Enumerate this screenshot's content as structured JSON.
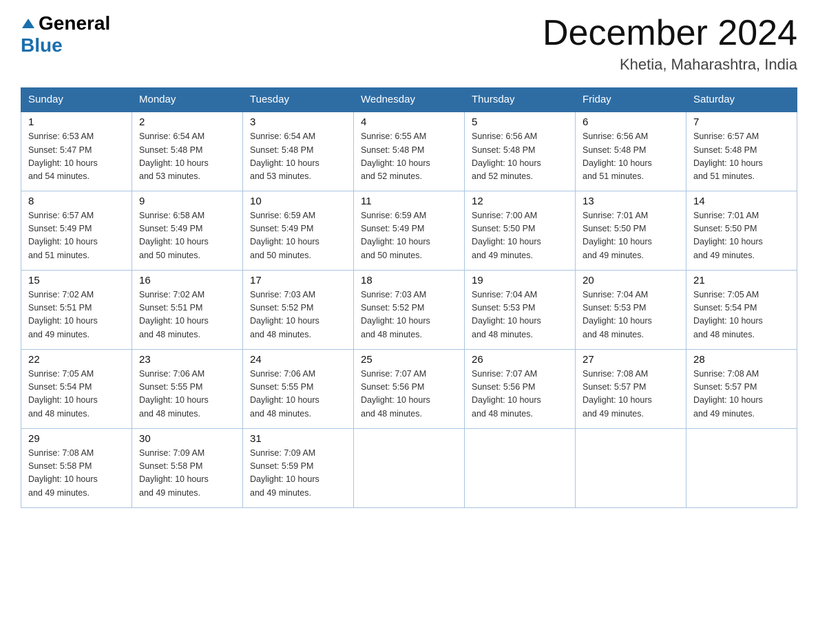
{
  "logo": {
    "part1": "General",
    "part2": "Blue"
  },
  "header": {
    "month_year": "December 2024",
    "location": "Khetia, Maharashtra, India"
  },
  "days_of_week": [
    "Sunday",
    "Monday",
    "Tuesday",
    "Wednesday",
    "Thursday",
    "Friday",
    "Saturday"
  ],
  "weeks": [
    [
      {
        "day": "1",
        "sunrise": "6:53 AM",
        "sunset": "5:47 PM",
        "daylight": "10 hours and 54 minutes."
      },
      {
        "day": "2",
        "sunrise": "6:54 AM",
        "sunset": "5:48 PM",
        "daylight": "10 hours and 53 minutes."
      },
      {
        "day": "3",
        "sunrise": "6:54 AM",
        "sunset": "5:48 PM",
        "daylight": "10 hours and 53 minutes."
      },
      {
        "day": "4",
        "sunrise": "6:55 AM",
        "sunset": "5:48 PM",
        "daylight": "10 hours and 52 minutes."
      },
      {
        "day": "5",
        "sunrise": "6:56 AM",
        "sunset": "5:48 PM",
        "daylight": "10 hours and 52 minutes."
      },
      {
        "day": "6",
        "sunrise": "6:56 AM",
        "sunset": "5:48 PM",
        "daylight": "10 hours and 51 minutes."
      },
      {
        "day": "7",
        "sunrise": "6:57 AM",
        "sunset": "5:48 PM",
        "daylight": "10 hours and 51 minutes."
      }
    ],
    [
      {
        "day": "8",
        "sunrise": "6:57 AM",
        "sunset": "5:49 PM",
        "daylight": "10 hours and 51 minutes."
      },
      {
        "day": "9",
        "sunrise": "6:58 AM",
        "sunset": "5:49 PM",
        "daylight": "10 hours and 50 minutes."
      },
      {
        "day": "10",
        "sunrise": "6:59 AM",
        "sunset": "5:49 PM",
        "daylight": "10 hours and 50 minutes."
      },
      {
        "day": "11",
        "sunrise": "6:59 AM",
        "sunset": "5:49 PM",
        "daylight": "10 hours and 50 minutes."
      },
      {
        "day": "12",
        "sunrise": "7:00 AM",
        "sunset": "5:50 PM",
        "daylight": "10 hours and 49 minutes."
      },
      {
        "day": "13",
        "sunrise": "7:01 AM",
        "sunset": "5:50 PM",
        "daylight": "10 hours and 49 minutes."
      },
      {
        "day": "14",
        "sunrise": "7:01 AM",
        "sunset": "5:50 PM",
        "daylight": "10 hours and 49 minutes."
      }
    ],
    [
      {
        "day": "15",
        "sunrise": "7:02 AM",
        "sunset": "5:51 PM",
        "daylight": "10 hours and 49 minutes."
      },
      {
        "day": "16",
        "sunrise": "7:02 AM",
        "sunset": "5:51 PM",
        "daylight": "10 hours and 48 minutes."
      },
      {
        "day": "17",
        "sunrise": "7:03 AM",
        "sunset": "5:52 PM",
        "daylight": "10 hours and 48 minutes."
      },
      {
        "day": "18",
        "sunrise": "7:03 AM",
        "sunset": "5:52 PM",
        "daylight": "10 hours and 48 minutes."
      },
      {
        "day": "19",
        "sunrise": "7:04 AM",
        "sunset": "5:53 PM",
        "daylight": "10 hours and 48 minutes."
      },
      {
        "day": "20",
        "sunrise": "7:04 AM",
        "sunset": "5:53 PM",
        "daylight": "10 hours and 48 minutes."
      },
      {
        "day": "21",
        "sunrise": "7:05 AM",
        "sunset": "5:54 PM",
        "daylight": "10 hours and 48 minutes."
      }
    ],
    [
      {
        "day": "22",
        "sunrise": "7:05 AM",
        "sunset": "5:54 PM",
        "daylight": "10 hours and 48 minutes."
      },
      {
        "day": "23",
        "sunrise": "7:06 AM",
        "sunset": "5:55 PM",
        "daylight": "10 hours and 48 minutes."
      },
      {
        "day": "24",
        "sunrise": "7:06 AM",
        "sunset": "5:55 PM",
        "daylight": "10 hours and 48 minutes."
      },
      {
        "day": "25",
        "sunrise": "7:07 AM",
        "sunset": "5:56 PM",
        "daylight": "10 hours and 48 minutes."
      },
      {
        "day": "26",
        "sunrise": "7:07 AM",
        "sunset": "5:56 PM",
        "daylight": "10 hours and 48 minutes."
      },
      {
        "day": "27",
        "sunrise": "7:08 AM",
        "sunset": "5:57 PM",
        "daylight": "10 hours and 49 minutes."
      },
      {
        "day": "28",
        "sunrise": "7:08 AM",
        "sunset": "5:57 PM",
        "daylight": "10 hours and 49 minutes."
      }
    ],
    [
      {
        "day": "29",
        "sunrise": "7:08 AM",
        "sunset": "5:58 PM",
        "daylight": "10 hours and 49 minutes."
      },
      {
        "day": "30",
        "sunrise": "7:09 AM",
        "sunset": "5:58 PM",
        "daylight": "10 hours and 49 minutes."
      },
      {
        "day": "31",
        "sunrise": "7:09 AM",
        "sunset": "5:59 PM",
        "daylight": "10 hours and 49 minutes."
      },
      null,
      null,
      null,
      null
    ]
  ],
  "labels": {
    "sunrise": "Sunrise:",
    "sunset": "Sunset:",
    "daylight": "Daylight:"
  }
}
